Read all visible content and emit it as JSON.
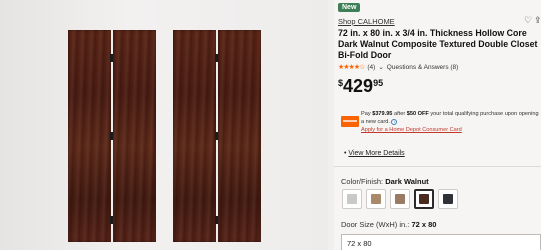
{
  "product": {
    "badge": "New",
    "shop_link": "Shop CALHOME",
    "title": "72 in. x 80 in. x 3/4 in. Thickness Hollow Core Dark Walnut Composite Textured Double Closet Bi-Fold Door",
    "rating_count": "(4)",
    "stars": "★★★★☆",
    "qa_link": "Questions & Answers (8)",
    "price": {
      "currency": "$",
      "dollars": "429",
      "cents": "95"
    }
  },
  "icons": {
    "heart": "heart-icon",
    "share": "share-icon",
    "chevron": "chevron-down-icon",
    "info": "info-icon",
    "card": "credit-card-icon"
  },
  "promo": {
    "line_prefix": "Pay ",
    "new_price": "$379.95",
    "line_mid": " after ",
    "discount": "$50 OFF",
    "line_suffix": " your total qualifying purchase upon opening a new card.",
    "apply_link": "Apply for a Home Depot Consumer Card"
  },
  "details": {
    "view_more": "View More Details"
  },
  "color": {
    "label": "Color/Finish: ",
    "selected": "Dark Walnut",
    "swatches": [
      "#c9c9c6",
      "#a8896a",
      "#9a7a62",
      "#4a2a1c",
      "#2f3236"
    ]
  },
  "size": {
    "label": "Door Size (WxH) in.: ",
    "selected": "72 x 80",
    "field_value": "72 x 80"
  },
  "colors": {
    "accent": "#f96302",
    "badge": "#3e7f57",
    "door": "#4f1f14"
  }
}
